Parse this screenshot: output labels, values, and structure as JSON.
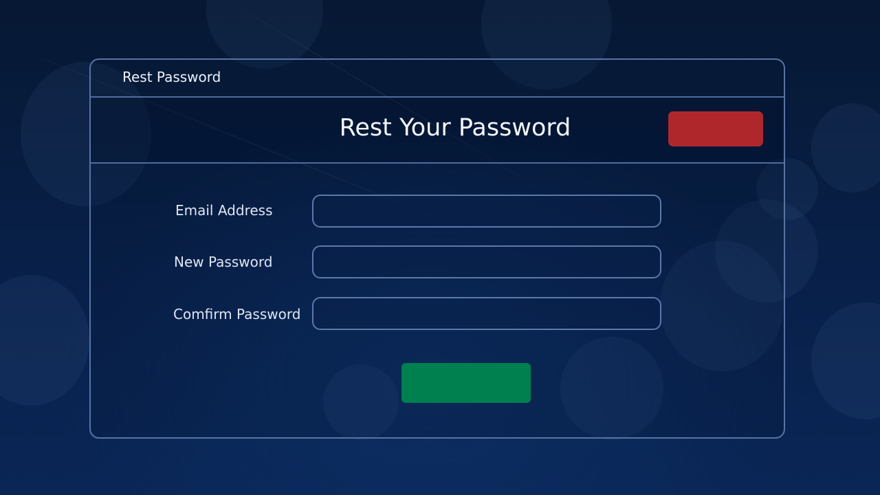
{
  "window": {
    "title": "Rest Password"
  },
  "header": {
    "title": "Rest Your Password",
    "close_button_color": "#b0272b"
  },
  "form": {
    "fields": [
      {
        "label": "Email Address",
        "value": ""
      },
      {
        "label": "New Password",
        "value": ""
      },
      {
        "label": "Comfirm Password",
        "value": ""
      }
    ],
    "submit_button_color": "#007f4f"
  },
  "colors": {
    "background": "#082049",
    "panel_border": "#5774a6"
  }
}
